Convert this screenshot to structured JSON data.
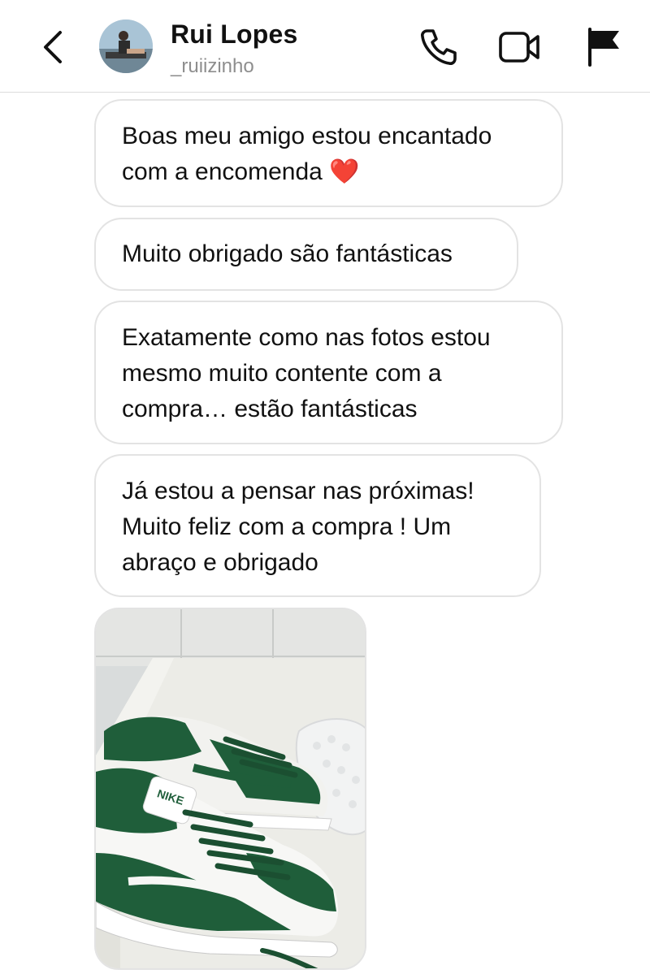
{
  "header": {
    "contact_name": "Rui Lopes",
    "username": "_ruiizinho",
    "icons": [
      "back-icon",
      "phone-icon",
      "video-camera-icon",
      "flag-icon"
    ]
  },
  "messages": [
    {
      "lines": [
        "Boas meu amigo estou encantado",
        "com a encomenda ❤️"
      ]
    },
    {
      "lines": [
        "Muito obrigado são fantásticas"
      ]
    },
    {
      "lines": [
        "Exatamente como nas fotos estou",
        "mesmo muito contente com a",
        "compra… estão fantásticas"
      ]
    },
    {
      "lines": [
        "Já estou a pensar nas próximas!",
        "Muito feliz com a compra ! Um",
        "abraço e obrigado"
      ]
    }
  ],
  "photo": {
    "brand_text": "NIKE"
  },
  "colors": {
    "shoe_green": "#1f5e3a",
    "bubble_border": "#e3e3e3",
    "muted_text": "#8e8e8e"
  }
}
